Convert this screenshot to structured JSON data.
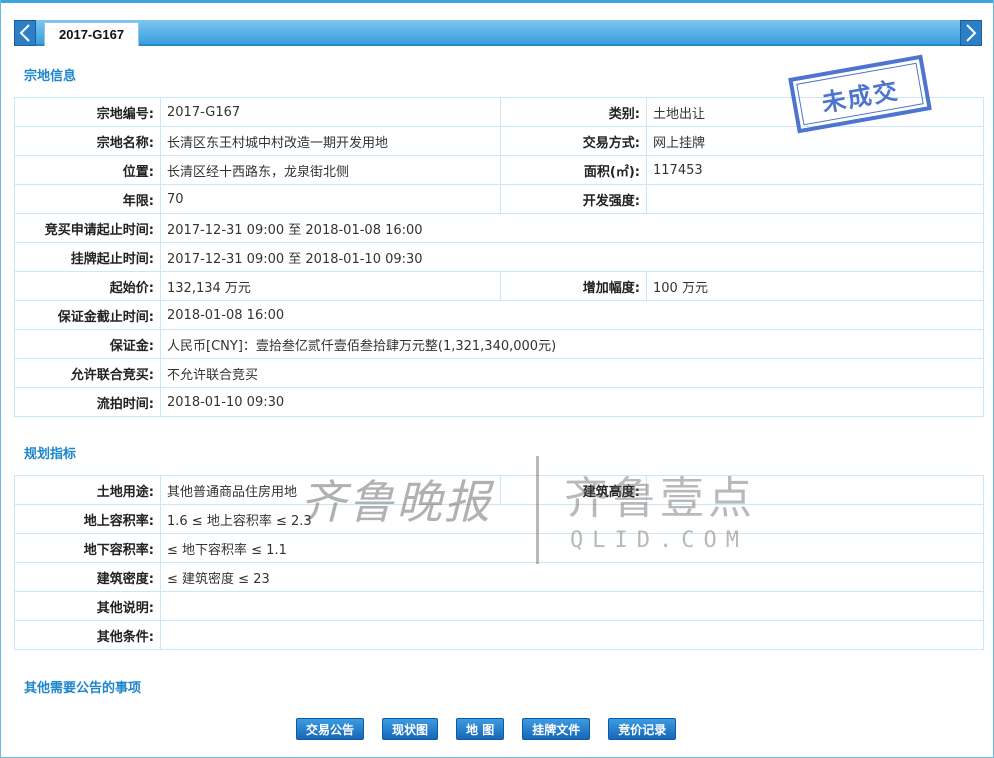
{
  "tab": {
    "title": "2017-G167"
  },
  "stamp": {
    "text": "未成交"
  },
  "watermark": {
    "left_text": "齐鲁晚报",
    "right_text": "齐鲁壹点",
    "sub_text": "QLID.COM"
  },
  "sections": {
    "land_info": "宗地信息",
    "planning": "规划指标",
    "other_notice": "其他需要公告的事项"
  },
  "land_info": {
    "rows": [
      {
        "l1": "宗地编号:",
        "v1": "2017-G167",
        "l2": "类别:",
        "v2": "土地出让"
      },
      {
        "l1": "宗地名称:",
        "v1": "长清区东王村城中村改造一期开发用地",
        "l2": "交易方式:",
        "v2": "网上挂牌"
      },
      {
        "l1": "位置:",
        "v1": "长清区经十西路东，龙泉街北侧",
        "l2": "面积(㎡):",
        "v2": "117453"
      },
      {
        "l1": "年限:",
        "v1": "70",
        "l2": "开发强度:",
        "v2": ""
      },
      {
        "l1": "竞买申请起止时间:",
        "v1": "2017-12-31 09:00 至 2018-01-08 16:00"
      },
      {
        "l1": "挂牌起止时间:",
        "v1": "2017-12-31 09:00 至 2018-01-10 09:30"
      },
      {
        "l1": "起始价:",
        "v1": "132,134 万元",
        "l2": "增加幅度:",
        "v2": "100 万元"
      },
      {
        "l1": "保证金截止时间:",
        "v1": "2018-01-08 16:00"
      },
      {
        "l1": "保证金:",
        "v1": "人民币[CNY]：壹拾叁亿贰仟壹佰叁拾肆万元整(1,321,340,000元)"
      },
      {
        "l1": "允许联合竞买:",
        "v1": "不允许联合竞买"
      },
      {
        "l1": "流拍时间:",
        "v1": "2018-01-10 09:30"
      }
    ]
  },
  "planning": {
    "rows": [
      {
        "l1": "土地用途:",
        "v1": "其他普通商品住房用地",
        "l2": "建筑高度:",
        "v2": ""
      },
      {
        "l1": "地上容积率:",
        "v1": "1.6 ≤ 地上容积率 ≤ 2.3"
      },
      {
        "l1": "地下容积率:",
        "v1": "≤ 地下容积率 ≤ 1.1"
      },
      {
        "l1": "建筑密度:",
        "v1": "≤ 建筑密度 ≤ 23"
      },
      {
        "l1": "其他说明:",
        "v1": ""
      },
      {
        "l1": "其他条件:",
        "v1": ""
      }
    ]
  },
  "buttons": [
    "交易公告",
    "现状图",
    "地 图",
    "挂牌文件",
    "竞价记录"
  ]
}
